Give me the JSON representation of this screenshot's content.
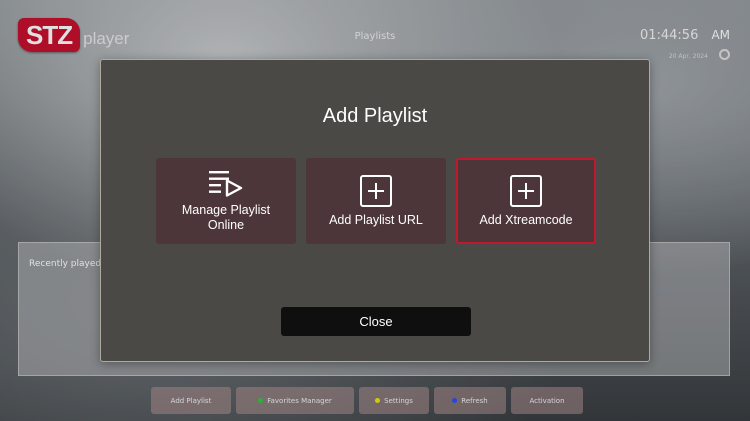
{
  "app": {
    "logo_badge": "STZ",
    "logo_text": "player",
    "page_title": "Playlists"
  },
  "clock": {
    "time": "01:44:56",
    "ampm": "AM",
    "date": "20 Apr, 2024",
    "settings_icon": "gear-icon"
  },
  "recent": {
    "label": "Recently played"
  },
  "bottom_bar": [
    {
      "label": "Add Playlist",
      "dot": ""
    },
    {
      "label": "Favorites Manager",
      "dot": "#2ecc40"
    },
    {
      "label": "Settings",
      "dot": "#f1e40f"
    },
    {
      "label": "Refresh",
      "dot": "#2b50ff"
    },
    {
      "label": "Activation",
      "dot": ""
    }
  ],
  "modal": {
    "title": "Add Playlist",
    "options": [
      {
        "label": "Manage Playlist\nOnline",
        "icon": "playlist-play-icon",
        "selected": false
      },
      {
        "label": "Add Playlist URL",
        "icon": "plus-box-icon",
        "selected": false
      },
      {
        "label": "Add Xtreamcode",
        "icon": "plus-box-icon",
        "selected": true
      }
    ],
    "close_label": "Close"
  },
  "colors": {
    "accent_red": "#c0182c",
    "modal_bg": "#4a4946",
    "option_bg": "#4c3639",
    "close_bg": "#0f0f0f"
  }
}
